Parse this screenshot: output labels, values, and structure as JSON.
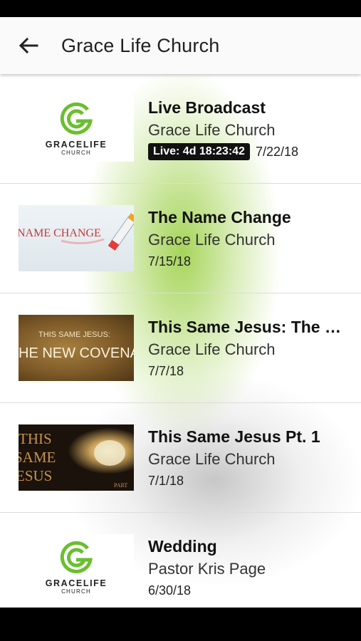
{
  "header": {
    "title": "Grace Life Church",
    "back_icon": "arrow-left-icon"
  },
  "logo": {
    "name": "GRACELIFE",
    "sub": "CHURCH",
    "color": "#6abf2e"
  },
  "items": [
    {
      "title": "Live Broadcast",
      "subtitle": "Grace Life Church",
      "live_badge": "Live: 4d 18:23:42",
      "date": "7/22/18",
      "thumb": "gracelife-logo"
    },
    {
      "title": "The Name Change",
      "subtitle": "Grace Life Church",
      "date": "7/15/18",
      "thumb": "name-change",
      "thumb_text": "NAME CHANGE"
    },
    {
      "title": "This Same Jesus: The New Covenant",
      "subtitle": "Grace Life Church",
      "date": "7/7/18",
      "thumb": "covenant",
      "thumb_text_1": "THIS SAME JESUS:",
      "thumb_text_2": "HE NEW COVENAN"
    },
    {
      "title": "This Same Jesus Pt. 1",
      "subtitle": "Grace Life Church",
      "date": "7/1/18",
      "thumb": "tomb",
      "thumb_text_1": "THIS",
      "thumb_text_2": "SAME",
      "thumb_text_3": "ESUS",
      "thumb_text_4": "PART"
    },
    {
      "title": "Wedding",
      "subtitle": "Pastor Kris Page",
      "date": "6/30/18",
      "thumb": "gracelife-logo"
    }
  ]
}
